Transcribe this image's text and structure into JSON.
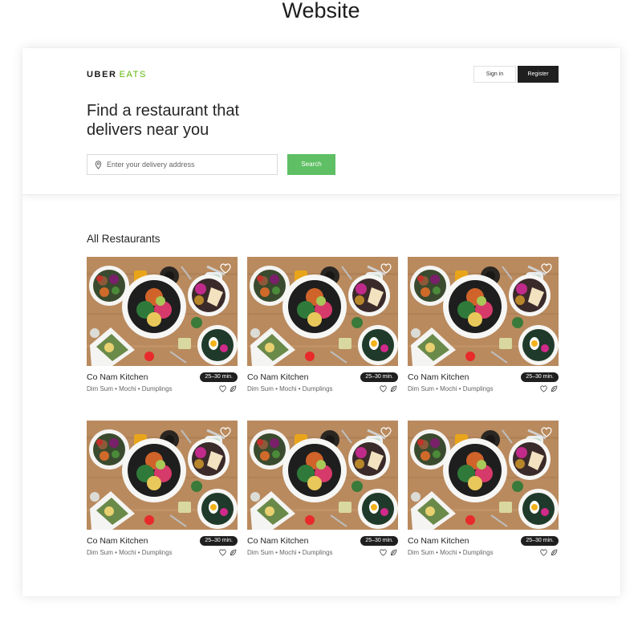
{
  "caption": "Website",
  "brand": {
    "word1": "UBER",
    "word2": "EATS",
    "accent": "#5fb709"
  },
  "header": {
    "signin_label": "Sign in",
    "register_label": "Register"
  },
  "hero": {
    "headline_line1": "Find a restaurant that",
    "headline_line2": "delivers near you"
  },
  "search": {
    "placeholder": "Enter your delivery address",
    "value": "",
    "button_label": "Search",
    "button_color": "#5fbf64",
    "icon": "location-pin-icon"
  },
  "section": {
    "title": "All Restaurants"
  },
  "restaurants": [
    {
      "name": "Co Nam Kitchen",
      "tags": "Dim Sum • Mochi • Dumplings",
      "eta": "25–30 min."
    },
    {
      "name": "Co Nam Kitchen",
      "tags": "Dim Sum • Mochi • Dumplings",
      "eta": "25–30 min."
    },
    {
      "name": "Co Nam Kitchen",
      "tags": "Dim Sum • Mochi • Dumplings",
      "eta": "25–30 min."
    },
    {
      "name": "Co Nam Kitchen",
      "tags": "Dim Sum • Mochi • Dumplings",
      "eta": "25–30 min."
    },
    {
      "name": "Co Nam Kitchen",
      "tags": "Dim Sum • Mochi • Dumplings",
      "eta": "25–30 min."
    },
    {
      "name": "Co Nam Kitchen",
      "tags": "Dim Sum • Mochi • Dumplings",
      "eta": "25–30 min."
    }
  ],
  "card_icons": [
    "heart-icon",
    "leaf-icon"
  ]
}
